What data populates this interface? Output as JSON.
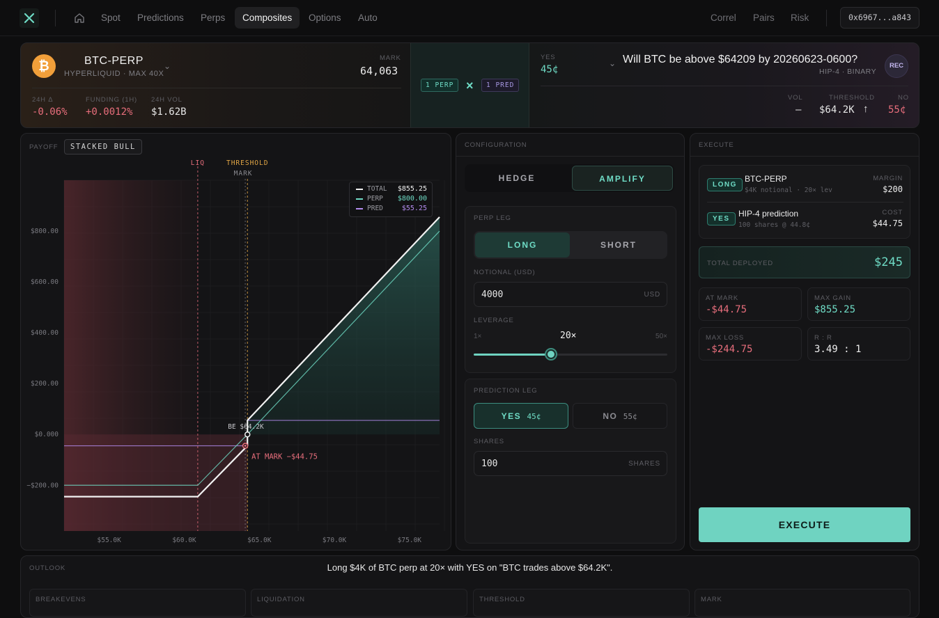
{
  "nav": {
    "items": [
      "Spot",
      "Predictions",
      "Perps",
      "Composites",
      "Options",
      "Auto"
    ],
    "active": "Composites",
    "right_items": [
      "Correl",
      "Pairs",
      "Risk"
    ],
    "wallet": "0x6967...a843"
  },
  "header": {
    "perp": {
      "symbol": "BTC-PERP",
      "venue": "HYPERLIQUID · MAX 40X",
      "mark_label": "MARK",
      "mark": "64,063",
      "change_label": "24H Δ",
      "change": "-0.06%",
      "funding_label": "FUNDING (1H)",
      "funding": "+0.0012%",
      "vol_label": "24H VOL",
      "vol": "$1.62B"
    },
    "combo": {
      "left": "1 PERP",
      "x": "×",
      "right": "1 PRED"
    },
    "pred": {
      "yes_label": "YES",
      "yes_price": "45¢",
      "question": "Will BTC be above $64209 by 20260623-0600?",
      "subtitle": "HIP-4 · BINARY",
      "badge": "REC",
      "vol_label": "VOL",
      "vol": "—",
      "threshold_label": "THRESHOLD",
      "threshold": "$64.2K",
      "no_label": "NO",
      "no_price": "55¢"
    }
  },
  "payoff": {
    "label": "PAYOFF",
    "strategy": "STACKED BULL",
    "markers": {
      "liq": "LIQ",
      "threshold": "THRESHOLD",
      "mark": "MARK"
    },
    "be_label": "BE $64.2K",
    "at_mark_label": "AT MARK −$44.75",
    "legend": [
      {
        "name": "TOTAL",
        "value": "$855.25",
        "color": "#f2f2f2"
      },
      {
        "name": "PERP",
        "value": "$800.00",
        "color": "#6fdcc6"
      },
      {
        "name": "PRED",
        "value": "$55.25",
        "color": "#b48cf0"
      }
    ]
  },
  "chart_data": {
    "type": "line",
    "x_ticks": [
      "$55.0K",
      "$60.0K",
      "$65.0K",
      "$70.0K",
      "$75.0K"
    ],
    "y_ticks": [
      "$800.00",
      "$600.00",
      "$400.00",
      "$200.00",
      "$0.000",
      "−$200.00"
    ],
    "xlim": [
      52000,
      77000
    ],
    "ylim": [
      -380,
      1000
    ],
    "liq": 60900,
    "threshold": 64209,
    "mark": 64063,
    "series": [
      {
        "name": "TOTAL",
        "color": "#f2f2f2",
        "x": [
          52000,
          60900,
          64209,
          64209,
          77000
        ],
        "y": [
          -244.75,
          -244.75,
          -44.75,
          55.25,
          855.25
        ]
      },
      {
        "name": "PERP",
        "color": "#6fdcc6",
        "x": [
          52000,
          60900,
          64209,
          77000
        ],
        "y": [
          -200,
          -200,
          0,
          800
        ]
      },
      {
        "name": "PRED",
        "color": "#b48cf0",
        "x": [
          52000,
          64209,
          64209,
          77000
        ],
        "y": [
          -44.75,
          -44.75,
          55.25,
          55.25
        ]
      }
    ],
    "points": [
      {
        "name": "BE",
        "x": 64209,
        "y": 0
      },
      {
        "name": "AT MARK",
        "x": 64063,
        "y": -44.75
      }
    ]
  },
  "config": {
    "title": "CONFIGURATION",
    "mode": {
      "hedge": "HEDGE",
      "amplify": "AMPLIFY",
      "active": "AMPLIFY"
    },
    "perp_leg_label": "PERP LEG",
    "long": "LONG",
    "short": "SHORT",
    "notional_label": "NOTIONAL (USD)",
    "notional": "4000",
    "notional_unit": "USD",
    "leverage_label": "LEVERAGE",
    "lev_min": "1×",
    "lev_value": "20×",
    "lev_max": "50×",
    "lev_level": 0.4,
    "pred_leg_label": "PREDICTION LEG",
    "yes": "YES",
    "yes_price": "45¢",
    "no": "NO",
    "no_price": "55¢",
    "shares_label": "SHARES",
    "shares": "100",
    "shares_unit": "SHARES"
  },
  "execute": {
    "title": "EXECUTE",
    "leg1": {
      "tag": "LONG",
      "name": "BTC-PERP",
      "detail": "$4K notional · 20× lev",
      "k": "MARGIN",
      "v": "$200"
    },
    "leg2": {
      "tag": "YES",
      "name": "HIP-4 prediction",
      "detail": "100 shares @ 44.8¢",
      "k": "COST",
      "v": "$44.75"
    },
    "total_label": "TOTAL DEPLOYED",
    "total": "$245",
    "at_mark_label": "AT MARK",
    "at_mark": "-$44.75",
    "max_gain_label": "MAX GAIN",
    "max_gain": "$855.25",
    "max_loss_label": "MAX LOSS",
    "max_loss": "-$244.75",
    "rr_label": "R : R",
    "rr": "3.49 : 1",
    "button": "EXECUTE"
  },
  "outlook": {
    "label": "OUTLOOK",
    "text": "Long $4K of BTC perp at 20× with YES on \"BTC trades above $64.2K\".",
    "cards": [
      "BREAKEVENS",
      "LIQUIDATION",
      "THRESHOLD",
      "MARK"
    ]
  },
  "colors": {
    "accent": "#6fd3c1",
    "negative": "#e86e7c",
    "positive": "#6fdcc6",
    "pred": "#b48cf0"
  }
}
